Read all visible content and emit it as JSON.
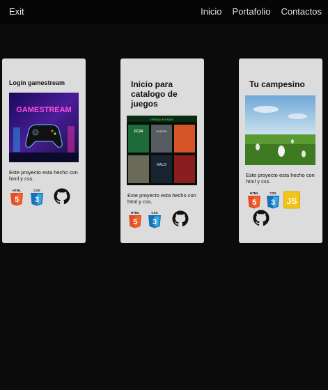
{
  "header": {
    "exit_label": "Exit",
    "nav": [
      "Inicio",
      "Portafolio",
      "Contactos"
    ]
  },
  "projects": [
    {
      "title": "Login gamestream",
      "image_text": "GAMESTREAM",
      "description": "Este proyecto esta hecho con html y css.",
      "tech": [
        "html5-icon",
        "css3-icon",
        "github-icon"
      ]
    },
    {
      "title": "Inicio para catalogo de juegos",
      "image_text": "Catálogo de juegos",
      "description": "Este proyecto esta hecho con html y css.",
      "tech": [
        "html5-icon",
        "css3-icon",
        "github-icon"
      ]
    },
    {
      "title": "Tu campesino",
      "description": "Este proyecto esta hecho con html y css.",
      "tech": [
        "html5-icon",
        "css3-icon",
        "js-icon",
        "github-icon"
      ]
    }
  ],
  "icon_labels": {
    "html": "HTML",
    "css": "CSS",
    "js": "JS"
  },
  "colors": {
    "background": "#0b0b0b",
    "card": "#dcdcdc",
    "html5": "#e44d26",
    "css3": "#2965f1",
    "js": "#f0c419",
    "github": "#111111"
  }
}
